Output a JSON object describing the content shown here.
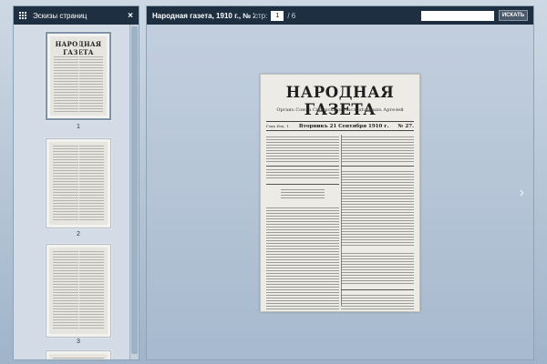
{
  "sidebar": {
    "title": "Эскизы страниц",
    "thumbnails": [
      {
        "number": "1",
        "masthead": "НАРОДНАЯ ГАЗЕТА"
      },
      {
        "number": "2"
      },
      {
        "number": "3"
      }
    ]
  },
  "toolbar": {
    "document_title": "Народная газета, 1910 г., № 27",
    "page_label": "стр:",
    "page_value": "1",
    "page_total": "/ 6",
    "search_placeholder": "",
    "search_button": "ИСКАТЬ"
  },
  "newspaper": {
    "masthead": "НАРОДНАЯ ГАЗЕТА",
    "subtitle": "Органъ Союза Сибирскихъ Маслодѣльныхъ Артелей",
    "dateline_left": "Годъ Изд. 1.",
    "dateline_center": "Вторникъ 21 Сентября 1910 г.",
    "dateline_right": "№ 27."
  }
}
